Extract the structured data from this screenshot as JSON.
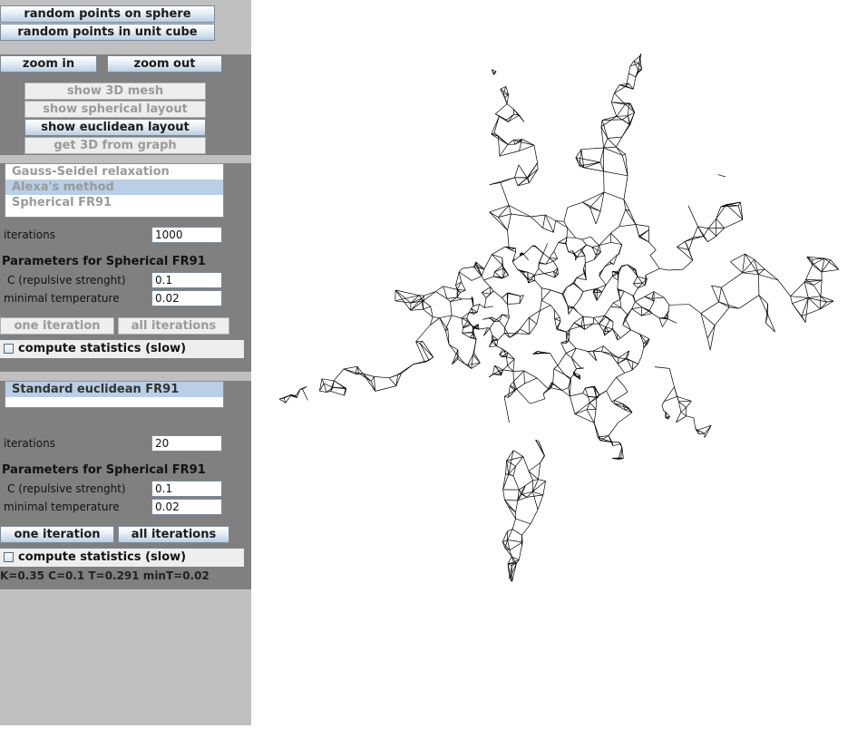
{
  "top_buttons": {
    "random_sphere": "random points on sphere",
    "random_cube": "random points in unit cube"
  },
  "zoom": {
    "zoom_in": "zoom in",
    "zoom_out": "zoom out"
  },
  "view_buttons": {
    "show_mesh": "show 3D mesh",
    "show_spherical": "show spherical layout",
    "show_euclidean": "show euclidean layout",
    "get_3d": "get 3D from graph"
  },
  "spherical_panel": {
    "methods": [
      {
        "label": "Gauss-Seidel relaxation"
      },
      {
        "label": "Alexa's method"
      },
      {
        "label": "Spherical FR91"
      }
    ],
    "iterations_label": "iterations",
    "iterations_value": "1000",
    "params_title": "Parameters for Spherical FR91",
    "c_label": "C (repulsive strenght)",
    "c_value": "0.1",
    "min_temp_label": "minimal temperature",
    "min_temp_value": "0.02",
    "one_iteration": "one iteration",
    "all_iterations": "all iterations",
    "compute_stats": "compute statistics (slow)"
  },
  "euclidean_panel": {
    "methods": [
      {
        "label": "Standard euclidean FR91"
      }
    ],
    "iterations_label": "iterations",
    "iterations_value": "20",
    "params_title": "Parameters for Spherical FR91",
    "c_label": "C (repulsive strenght)",
    "c_value": "0.1",
    "min_temp_label": "minimal temperature",
    "min_temp_value": "0.02",
    "one_iteration": "one iteration",
    "all_iterations": "all iterations",
    "compute_stats": "compute statistics (slow)",
    "status": "K=0.35 C=0.1 T=0.291 minT=0.02"
  },
  "colors": {
    "sidebar_bg": "#c0c0c0",
    "panel_bg": "#808080",
    "selection": "#b8cfe5",
    "mesh_stroke": "#000000"
  }
}
